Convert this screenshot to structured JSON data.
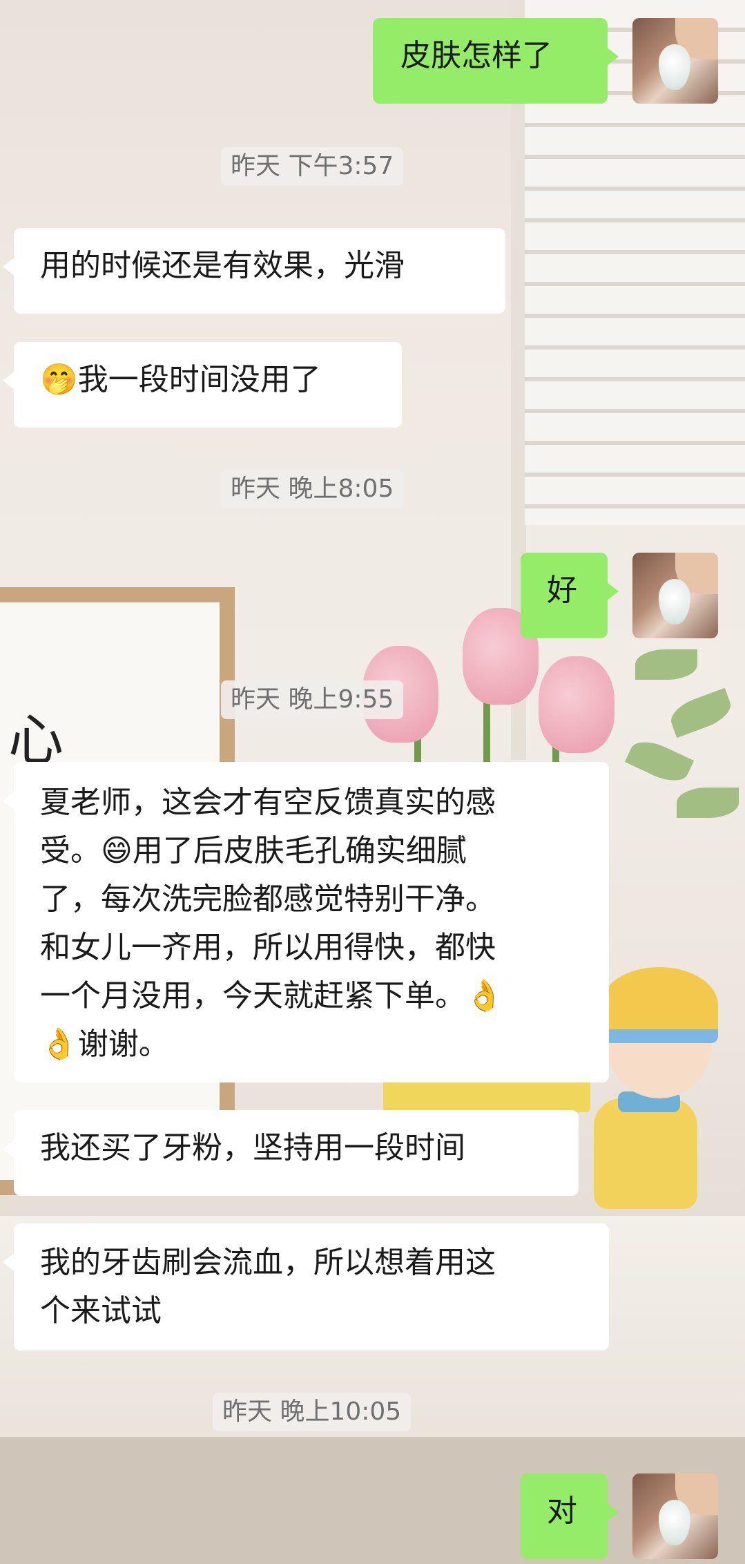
{
  "messages": [
    {
      "type": "out",
      "text": "皮肤怎样了"
    },
    {
      "type": "time",
      "text": "昨天 下午3:57"
    },
    {
      "type": "in",
      "text": "用的时候还是有效果，光滑"
    },
    {
      "type": "in",
      "emoji": "🤭",
      "text": "我一段时间没用了"
    },
    {
      "type": "time",
      "text": "昨天 晚上8:05"
    },
    {
      "type": "out",
      "text": "好"
    },
    {
      "type": "time",
      "text": "昨天 晚上9:55"
    },
    {
      "type": "in",
      "lines": [
        "夏老师，这会才有空反馈真实的感",
        "受。😄用了后皮肤毛孔确实细腻",
        "了，每次洗完脸都感觉特别干净。",
        "和女儿一齐用，所以用得快，都快",
        "一个月没用，今天就赶紧下单。👌",
        "👌谢谢。"
      ]
    },
    {
      "type": "in",
      "text": "我还买了牙粉，坚持用一段时间"
    },
    {
      "type": "in",
      "lines": [
        "我的牙齿刷会流血，所以想着用这",
        "个来试试"
      ]
    },
    {
      "type": "time",
      "text": "昨天 晚上10:05"
    },
    {
      "type": "out",
      "text": "对"
    }
  ],
  "icons": {
    "avatar": "avatar-image"
  },
  "colors": {
    "outgoing_bubble": "#95ec69",
    "incoming_bubble": "#ffffff",
    "timestamp_text": "#6f6f6f"
  }
}
